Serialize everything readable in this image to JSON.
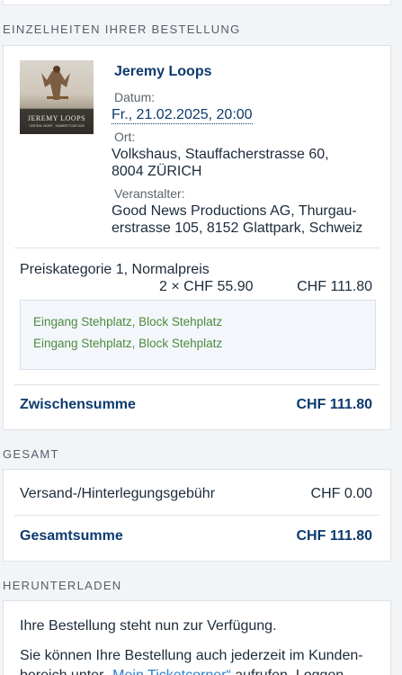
{
  "sections": {
    "details_heading": "EINZELHEITEN IHRER BESTELLUNG",
    "total_heading": "GESAMT",
    "download_heading": "HERUNTERLADEN"
  },
  "event": {
    "artist": "Jeremy Loops",
    "image_caption_title": "JEREMY LOOPS",
    "image_caption_sub": "CENTRAL HEART · SUMMER TOUR 2025",
    "date_label": "Datum:",
    "date_value": "Fr., 21.02.2025, 20:00",
    "venue_label": "Ort:",
    "venue_line1": "Volkshaus, Stauffacherstrasse 60,",
    "venue_line2": "8004 ZÜRICH",
    "organizer_label": "Veranstalter:",
    "organizer_line1": "Good News Productions AG, Thurgau-",
    "organizer_line2": "erstrasse 105, 8152 Glattpark, Schweiz"
  },
  "price": {
    "category": "Preiskategorie 1, Normalpreis",
    "quantity_price": "2 × CHF 55.90",
    "line_total": "CHF 111.80",
    "tickets": [
      "Eingang Stehplatz, Block Stehplatz",
      "Eingang Stehplatz, Block Stehplatz"
    ]
  },
  "subtotal": {
    "label": "Zwischensumme",
    "value": "CHF 111.80"
  },
  "total": {
    "shipping_label": "Versand-/Hinterlegungsgebühr",
    "shipping_value": "CHF 0.00",
    "grand_label": "Gesamtsumme",
    "grand_value": "CHF 111.80"
  },
  "download": {
    "line1": "Ihre Bestellung steht nun zur Verfügung.",
    "line2": "Sie können Ihre Bestellung auch jederzeit im Kunden-",
    "line3_prefix": "bereich unter ",
    "line3_link": "„Mein Ticketcorner“",
    "line3_suffix": " aufrufen. Loggen"
  },
  "colors": {
    "accent": "#0d3a6e",
    "link": "#2b7fc9",
    "ticket_text": "#4c8a3e",
    "background": "#f2f4f6"
  }
}
